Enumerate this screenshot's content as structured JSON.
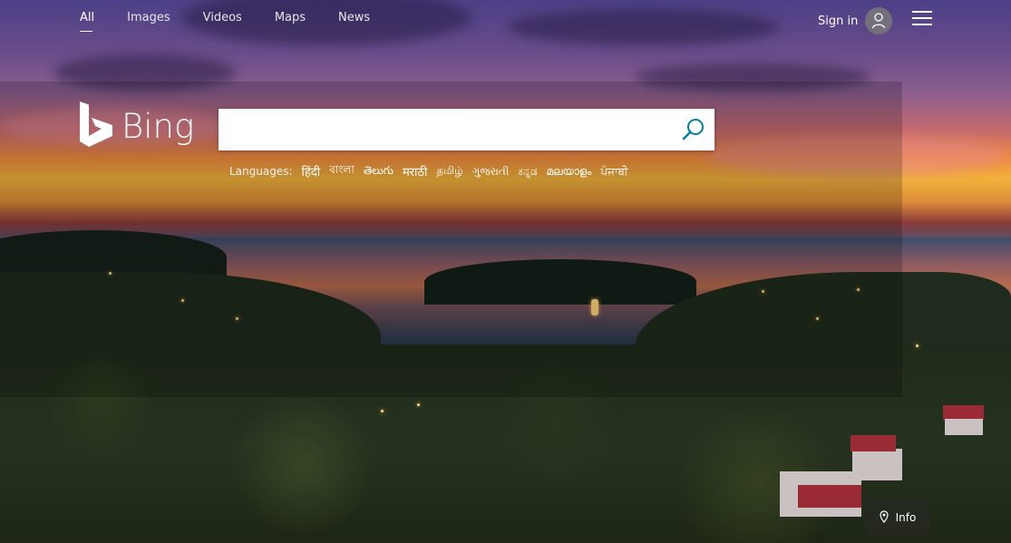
{
  "nav": {
    "items": [
      {
        "label": "All",
        "active": true
      },
      {
        "label": "Images",
        "active": false
      },
      {
        "label": "Videos",
        "active": false
      },
      {
        "label": "Maps",
        "active": false
      },
      {
        "label": "News",
        "active": false
      }
    ]
  },
  "header": {
    "signin_label": "Sign in",
    "avatar_icon": "person-icon",
    "menu_icon": "hamburger-icon"
  },
  "logo": {
    "text": "Bing",
    "icon": "bing-b-icon"
  },
  "search": {
    "value": "",
    "placeholder": "",
    "button_icon": "search-icon",
    "accent_color": "#00809d"
  },
  "languages": {
    "label": "Languages:",
    "items": [
      "हिंदी",
      "বাংলা",
      "తెలుగు",
      "मराठी",
      "தமிழ்",
      "ગુજરાતી",
      "ಕನ್ನಡ",
      "മലയാളം",
      "ਪੰਜਾਬੀ"
    ]
  },
  "info": {
    "label": "Info",
    "icon": "location-pin-icon"
  }
}
